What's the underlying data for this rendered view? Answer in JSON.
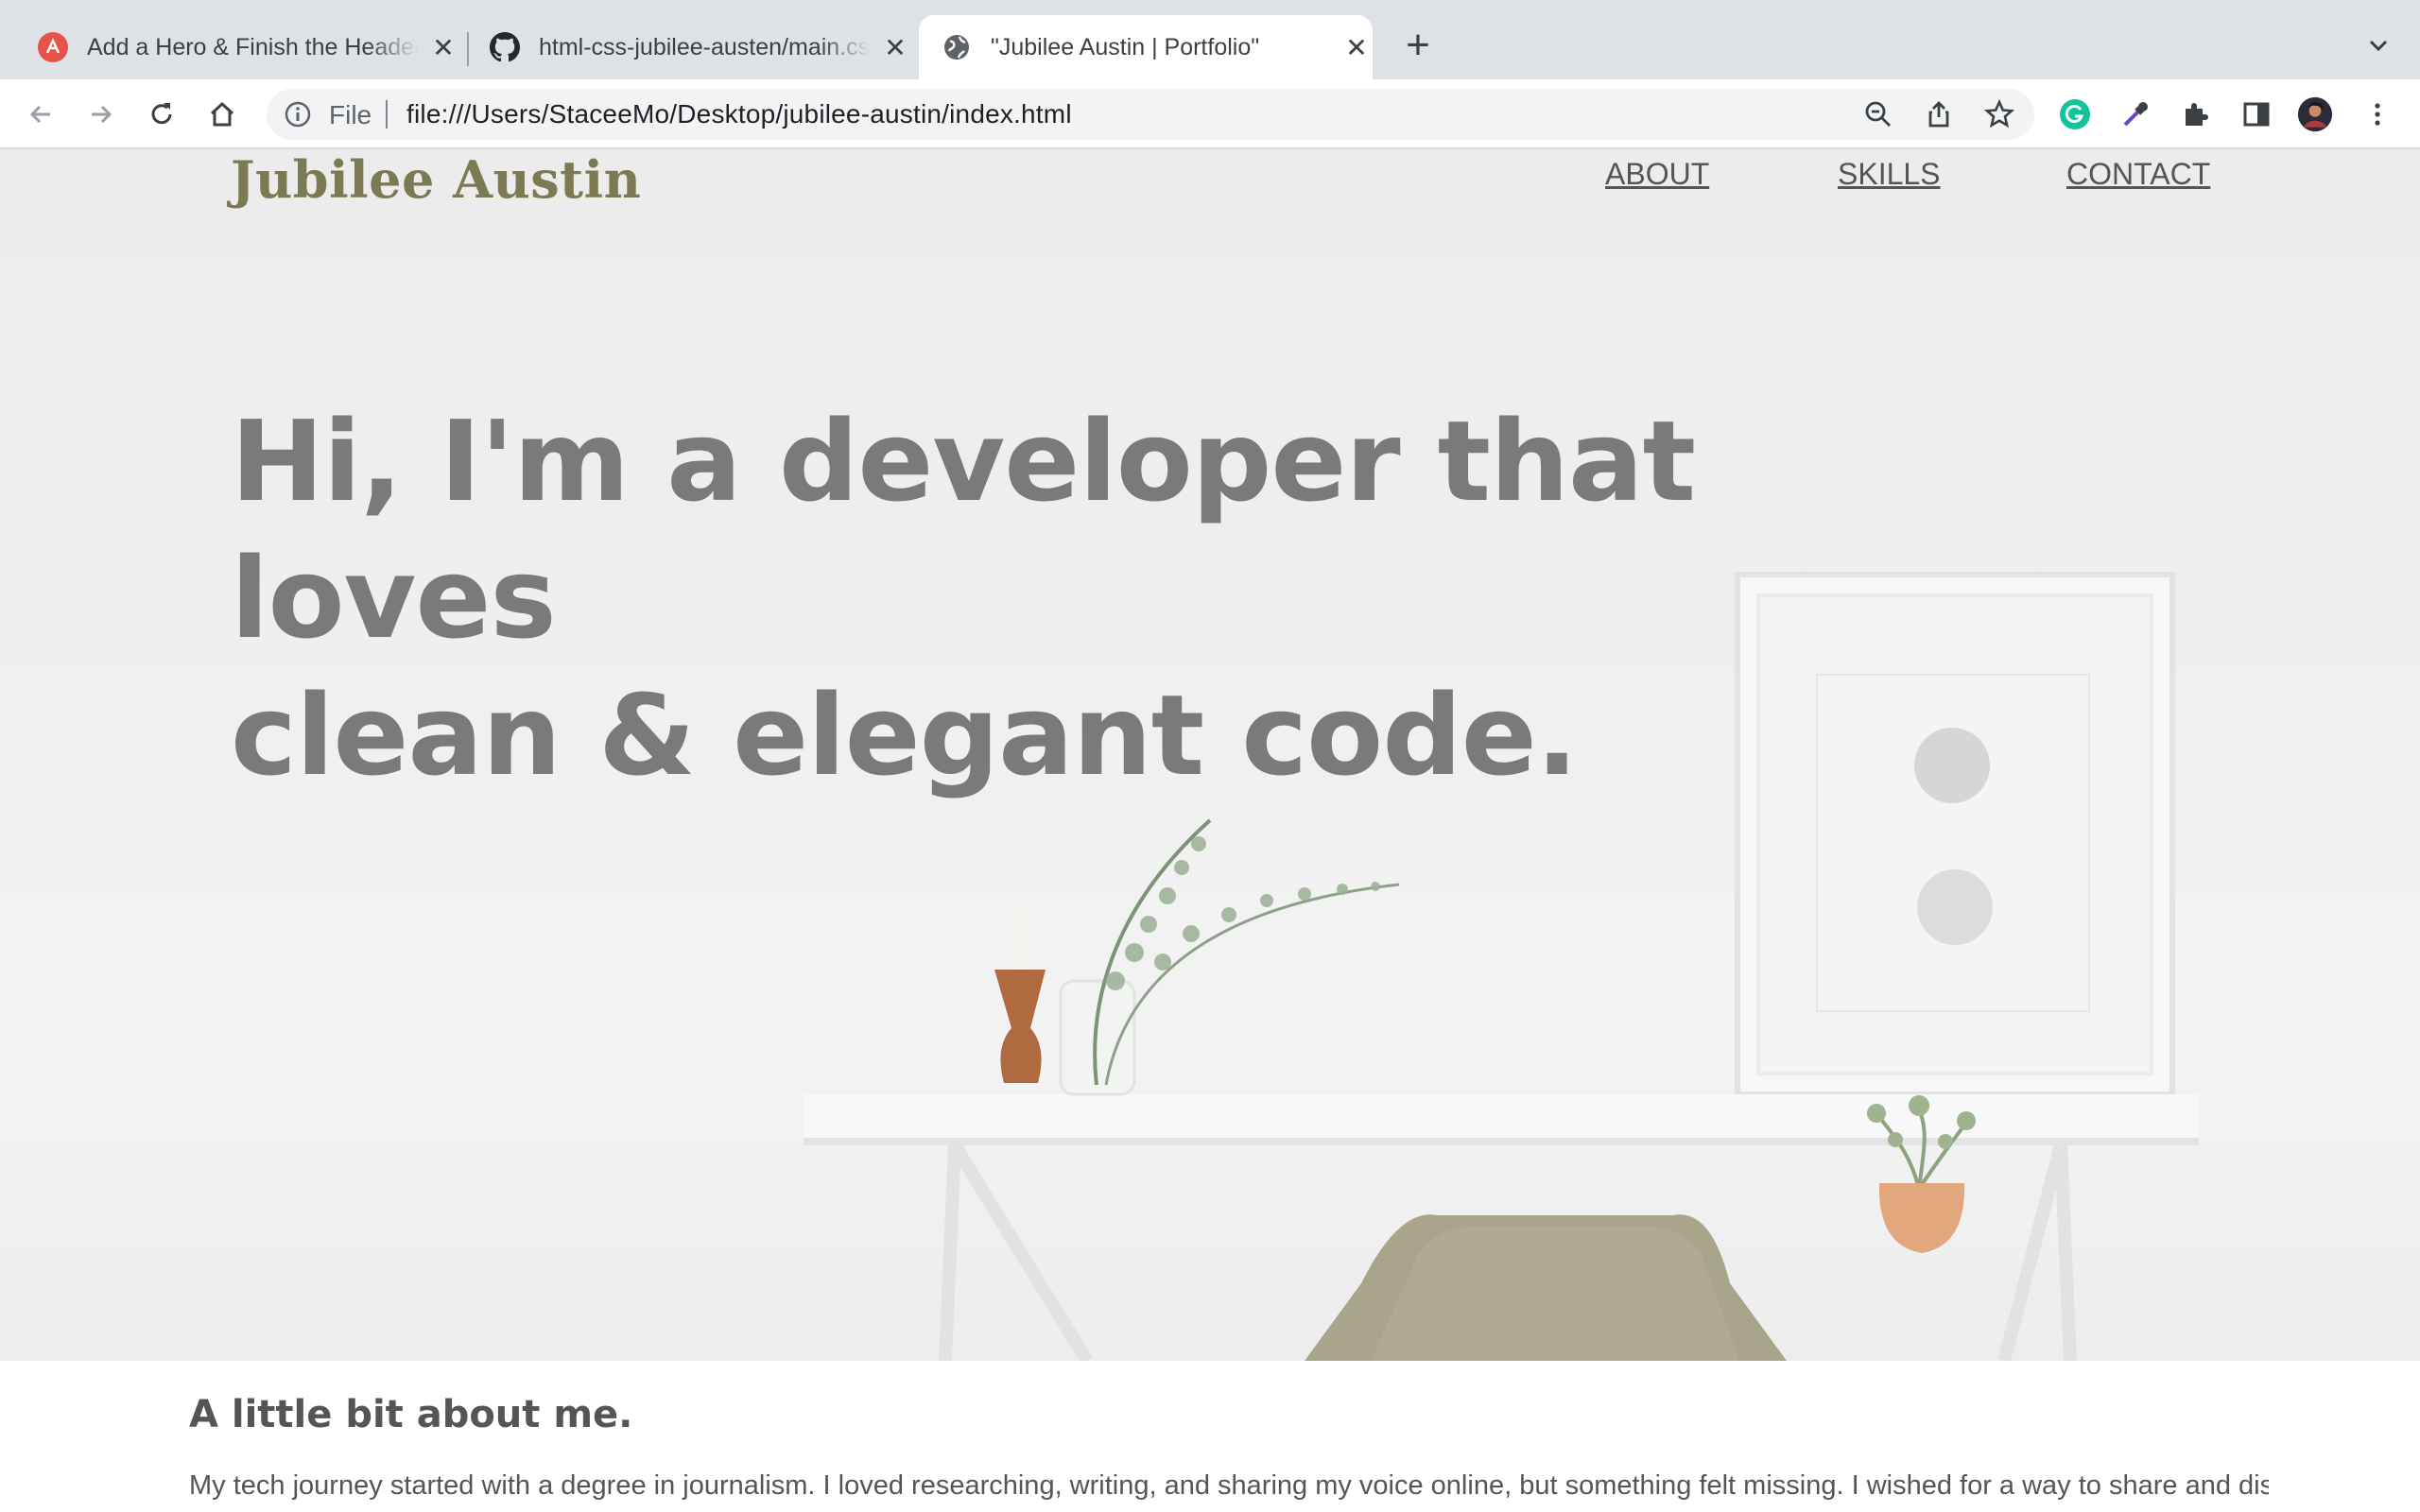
{
  "browser": {
    "tabs": [
      {
        "title": "Add a Hero & Finish the Header",
        "favicon": "app-icon",
        "active": false
      },
      {
        "title": "html-css-jubilee-austen/main.css",
        "favicon": "github-icon",
        "active": false
      },
      {
        "title": "\"Jubilee Austin | Portfolio\"",
        "favicon": "globe-icon",
        "active": true
      }
    ],
    "new_tab": "+",
    "address": {
      "scheme_label": "File",
      "url": "file:///Users/StaceeMo/Desktop/jubilee-austin/index.html"
    },
    "colors": {
      "tabstrip": "#dee1e6",
      "omnibox": "#f1f3f4",
      "grammarly": "#15c39a"
    }
  },
  "site": {
    "logo": "Jubilee Austin",
    "nav": [
      "ABOUT",
      "SKILLS",
      "CONTACT"
    ],
    "headline_line1": "Hi, I'm a developer that loves",
    "headline_line2": "clean & elegant code.",
    "about_heading": "A little bit about me.",
    "about_text": "My tech journey started with a degree in journalism. I loved researching, writing, and sharing my voice online, but something felt missing. I wished for a way to share and display",
    "colors": {
      "logo": "#7c7a52",
      "headline": "#7a7a7a",
      "text": "#555555",
      "chair": "#a8a58a"
    }
  }
}
